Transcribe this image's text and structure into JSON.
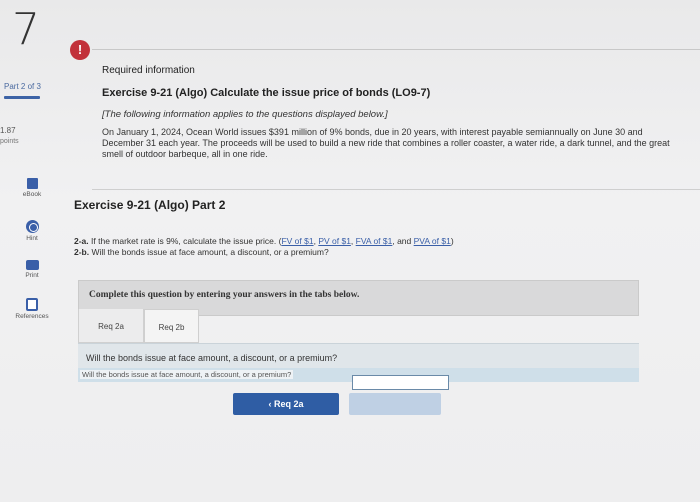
{
  "question_number": "7",
  "rail": {
    "part": "Part 2 of 3",
    "points_value": "1.87",
    "points_label": "points",
    "tools": [
      "eBook",
      "Hint",
      "Print",
      "References"
    ]
  },
  "required_info": {
    "title": "Required information",
    "exercise_title": "Exercise 9-21 (Algo) Calculate the issue price of bonds (LO9-7)",
    "subtitle": "[The following information applies to the questions displayed below.]",
    "body": "On January 1, 2024, Ocean World issues $391 million of 9% bonds, due in 20 years, with interest payable semiannually on June 30 and December 31 each year. The proceeds will be used to build a new ride that combines a roller coaster, a water ride, a dark tunnel, and the great smell of outdoor barbeque, all in one ride."
  },
  "part_title": "Exercise 9-21 (Algo) Part 2",
  "questions": {
    "q2a_label": "2-a.",
    "q2a_text": "If the market rate is 9%, calculate the issue price.",
    "links": [
      "FV of $1",
      "PV of $1",
      "FVA of $1",
      "PVA of $1"
    ],
    "q2b_label": "2-b.",
    "q2b_text": "Will the bonds issue at face amount, a discount, or a premium?"
  },
  "instruction": "Complete this question by entering your answers in the tabs below.",
  "tabs": [
    "Req 2a",
    "Req 2b"
  ],
  "panel": {
    "question": "Will the bonds issue at face amount, a discount, or a premium?",
    "answer_label": "Will the bonds issue at face amount, a discount, or a premium?",
    "answer_value": ""
  },
  "nav": {
    "prev_label": "Req 2a"
  },
  "colors": {
    "accent": "#2f5da4",
    "alert": "#c2313a",
    "link": "#3a5fa8"
  }
}
